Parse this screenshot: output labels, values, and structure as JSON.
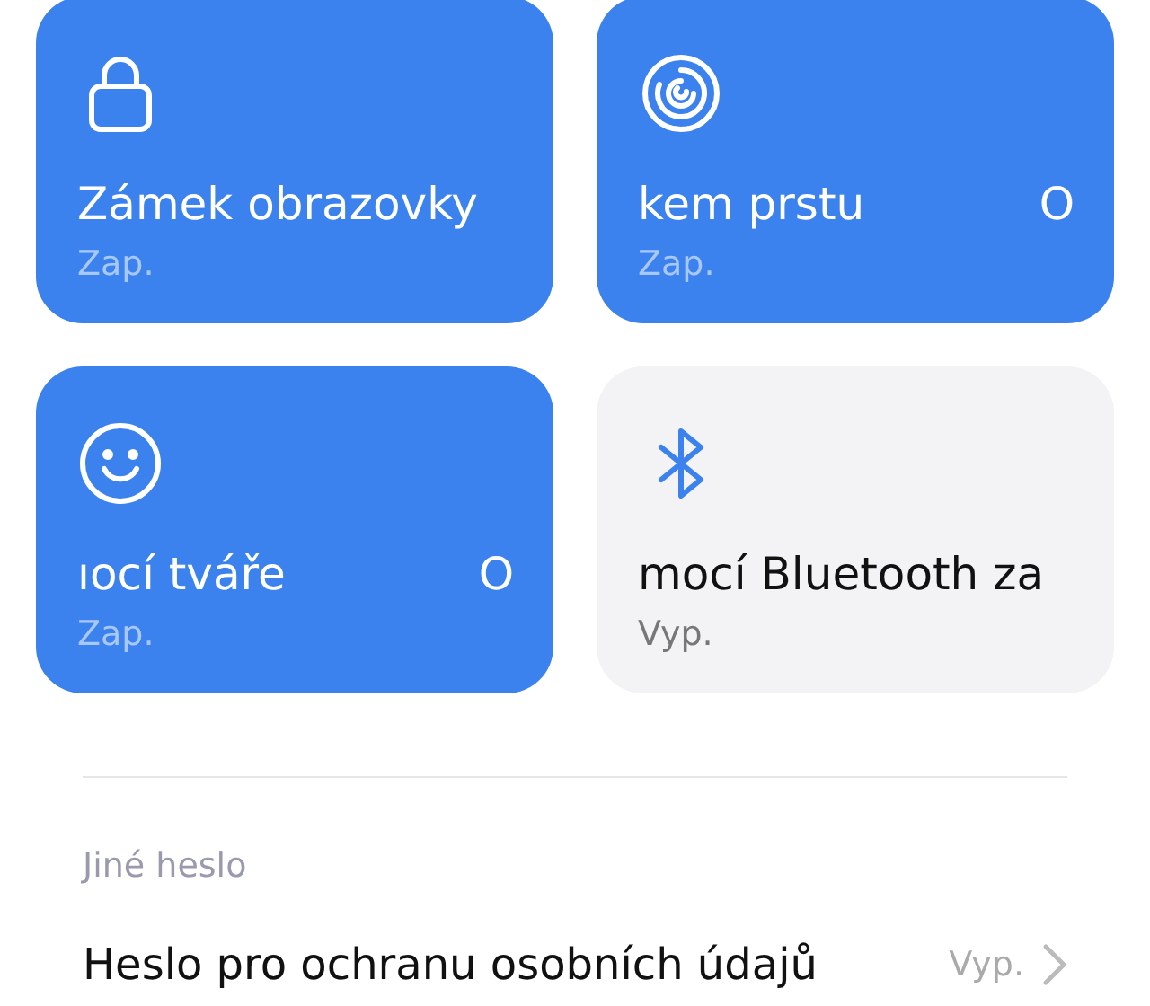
{
  "cards": [
    {
      "kind": "lock",
      "title": "Zámek obrazovky",
      "on": true,
      "status": "Zap."
    },
    {
      "kind": "fingerprint",
      "title": "kem prstu",
      "title_next": "O",
      "on": true,
      "status": "Zap."
    },
    {
      "kind": "face",
      "title": "ıocí tváře",
      "title_next": "O",
      "on": true,
      "status": "Zap."
    },
    {
      "kind": "bluetooth",
      "title": "mocí Bluetooth za",
      "on": false,
      "status": "Vyp."
    }
  ],
  "section": {
    "header": "Jiné heslo",
    "rows": [
      {
        "label": "Heslo pro ochranu osobních údajů",
        "value": "Vyp."
      }
    ]
  }
}
